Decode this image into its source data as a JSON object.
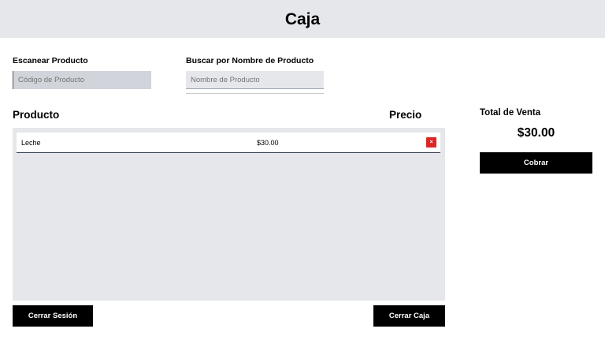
{
  "header": {
    "title": "Caja"
  },
  "scan": {
    "label": "Escanear Producto",
    "placeholder": "Código de Producto",
    "value": ""
  },
  "search": {
    "label": "Buscar por Nombre de Producto",
    "placeholder": "Nombre de Producto",
    "value": ""
  },
  "table": {
    "columns": [
      "Producto",
      "Precio"
    ],
    "rows": [
      {
        "name": "Leche",
        "price": "$30.00",
        "delete_label": "×"
      }
    ]
  },
  "summary": {
    "total_label": "Total de Venta",
    "total_value": "$30.00",
    "charge_label": "Cobrar"
  },
  "footer": {
    "logout_label": "Cerrar Sesión",
    "close_register_label": "Cerrar Caja"
  },
  "colors": {
    "header_bg": "#e5e7eb",
    "button_bg": "#000000",
    "delete_bg": "#dc2626"
  },
  "icons": {
    "delete": "close-icon"
  }
}
